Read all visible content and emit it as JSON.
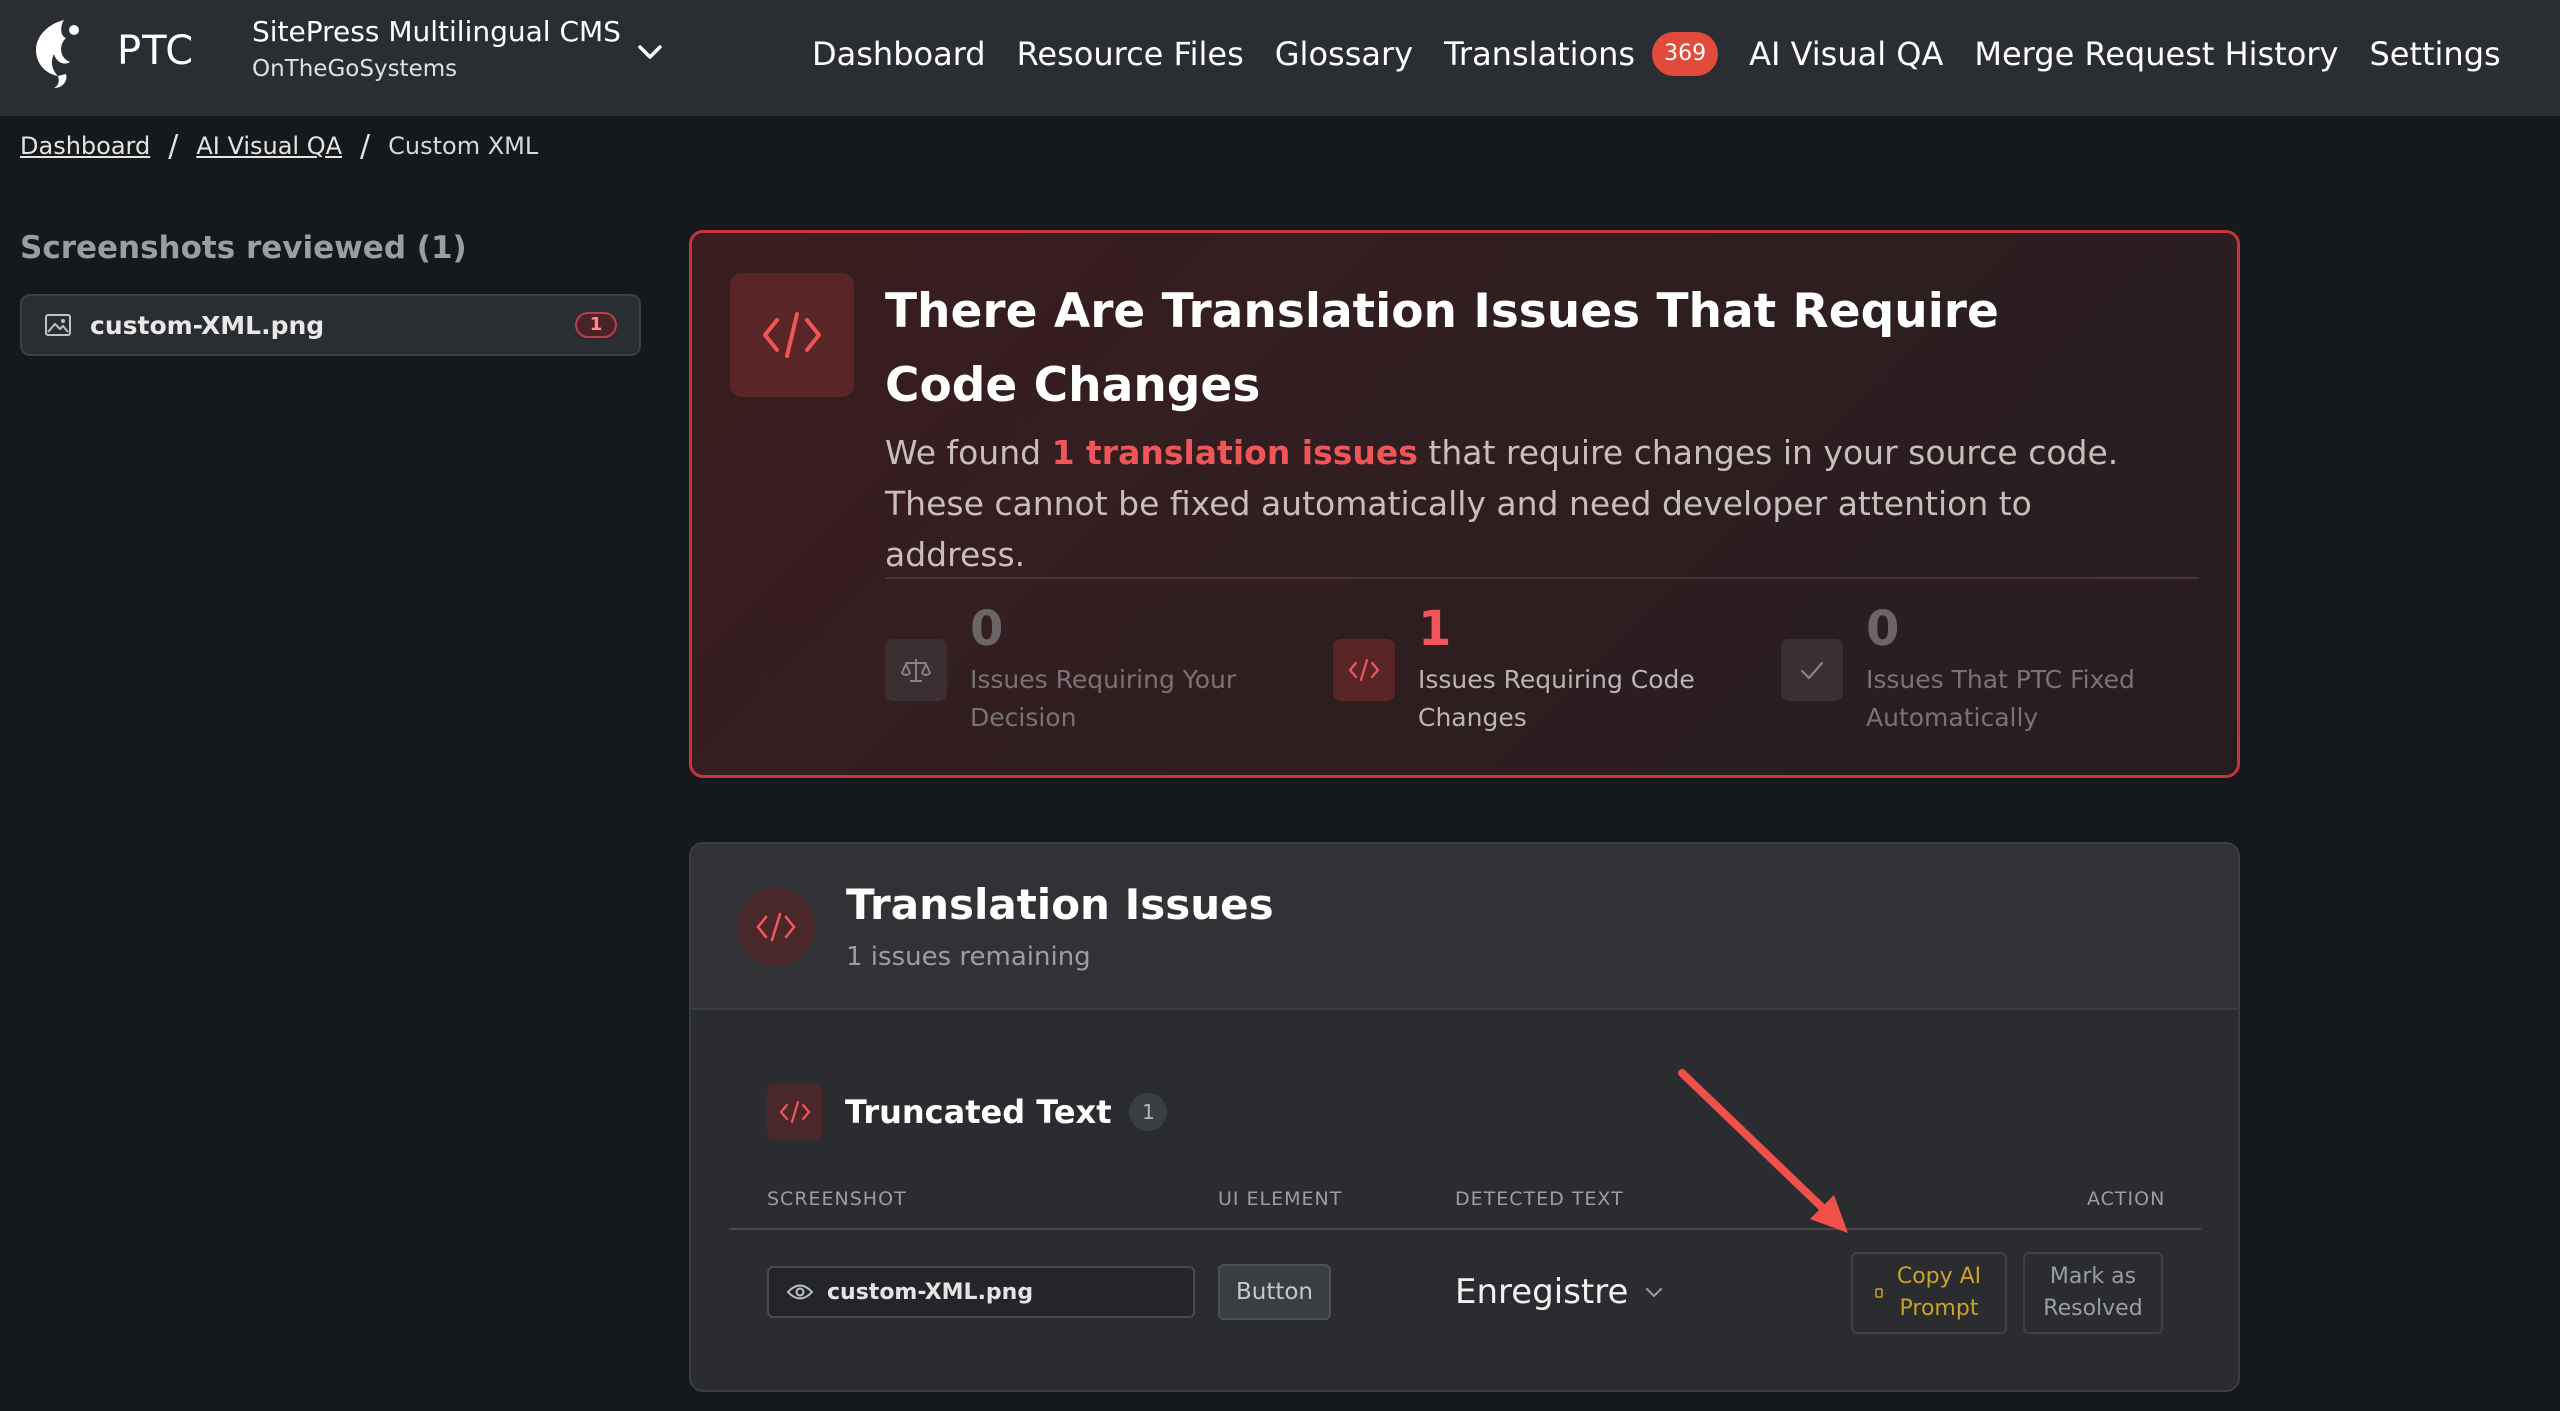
{
  "app": {
    "brand": "PTC",
    "project_name": "SitePress Multilingual CMS",
    "project_org": "OnTheGoSystems"
  },
  "nav": {
    "items": [
      {
        "label": "Dashboard"
      },
      {
        "label": "Resource Files"
      },
      {
        "label": "Glossary"
      },
      {
        "label": "Translations",
        "badge": "369"
      },
      {
        "label": "AI Visual QA"
      },
      {
        "label": "Merge Request History"
      },
      {
        "label": "Settings"
      }
    ]
  },
  "breadcrumb": {
    "items": [
      "Dashboard",
      "AI Visual QA"
    ],
    "current": "Custom XML"
  },
  "sidebar": {
    "title": "Screenshots reviewed (1)",
    "items": [
      {
        "label": "custom-XML.png",
        "count": "1"
      }
    ]
  },
  "alert": {
    "title": "There Are Translation Issues That Require Code Changes",
    "desc_before": "We found ",
    "desc_highlight": "1 translation issues",
    "desc_after": " that require changes in your source code. These cannot be fixed automatically and need developer attention to address.",
    "stats": [
      {
        "value": "0",
        "label": "Issues Requiring Your Decision",
        "icon": "scale-icon"
      },
      {
        "value": "1",
        "label": "Issues Requiring Code Changes",
        "icon": "code-icon"
      },
      {
        "value": "0",
        "label": "Issues That PTC Fixed Automatically",
        "icon": "check-icon"
      }
    ]
  },
  "issues": {
    "title": "Translation Issues",
    "subtitle": "1 issues remaining",
    "group": {
      "title": "Truncated Text",
      "count": "1"
    },
    "columns": [
      "SCREENSHOT",
      "UI ELEMENT",
      "DETECTED TEXT",
      "ACTION"
    ],
    "rows": [
      {
        "screenshot": "custom-XML.png",
        "ui_element": "Button",
        "detected_text": "Enregistre",
        "actions": [
          "Copy AI Prompt",
          "Mark as Resolved"
        ]
      }
    ]
  },
  "colors": {
    "accent_red": "#f0555a",
    "badge_red": "#e04b3b",
    "copy_gold": "#c9a227",
    "background": "#16191b"
  }
}
